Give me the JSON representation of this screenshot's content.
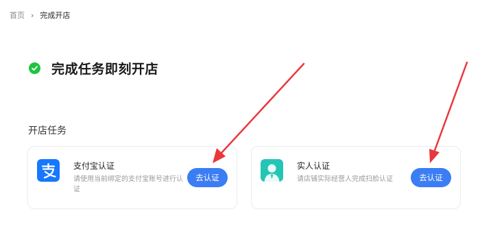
{
  "breadcrumb": {
    "home": "首页",
    "separator": "›",
    "current": "完成开店"
  },
  "hero": {
    "title": "完成任务即刻开店"
  },
  "section": {
    "title": "开店任务"
  },
  "tasks": [
    {
      "name": "支付宝认证",
      "description": "请使用当前绑定的支付宝账号进行认证",
      "button": "去认证",
      "icon": "alipay-icon"
    },
    {
      "name": "实人认证",
      "description": "请店铺实际经营人完成扫脸认证",
      "button": "去认证",
      "icon": "person-verify-icon"
    }
  ],
  "colors": {
    "accent": "#3b7df4",
    "success": "#1ec43f",
    "arrow": "#e8383d"
  }
}
